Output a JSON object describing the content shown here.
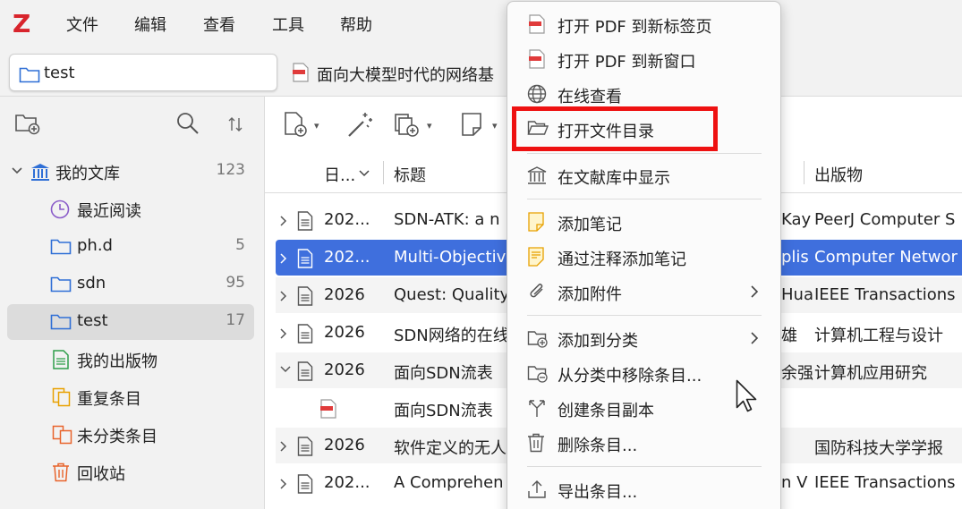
{
  "app": {
    "logo_letter": "Z"
  },
  "menubar": [
    "文件",
    "编辑",
    "查看",
    "工具",
    "帮助"
  ],
  "tabs": [
    {
      "label": "test",
      "active": true
    },
    {
      "label": "面向大模型时代的网络基",
      "active": false
    }
  ],
  "sidebar": {
    "tree": [
      {
        "label": "我的文库",
        "count": "123",
        "icon": "library-icon"
      },
      {
        "label": "最近阅读",
        "count": "",
        "icon": "clock-icon"
      },
      {
        "label": "ph.d",
        "count": "5",
        "icon": "folder-icon"
      },
      {
        "label": "sdn",
        "count": "95",
        "icon": "folder-icon"
      },
      {
        "label": "test",
        "count": "17",
        "icon": "folder-icon",
        "selected": true
      },
      {
        "label": "我的出版物",
        "count": "",
        "icon": "publications-icon"
      },
      {
        "label": "重复条目",
        "count": "",
        "icon": "duplicates-icon"
      },
      {
        "label": "未分类条目",
        "count": "",
        "icon": "unfiled-icon"
      },
      {
        "label": "回收站",
        "count": "",
        "icon": "trash-icon"
      }
    ]
  },
  "columns": {
    "date": "日...",
    "title": "标题",
    "publication": "出版物"
  },
  "rows": [
    {
      "date": "202...",
      "title": "SDN-ATK: a n",
      "creator": "Kay",
      "publication": "PeerJ Computer S"
    },
    {
      "date": "202...",
      "title": "Multi-Objectiv",
      "creator": "plis",
      "publication": "Computer Networ",
      "selected": true
    },
    {
      "date": "2026",
      "title": "Quest: Quality",
      "creator": "Hua",
      "publication": "IEEE Transactions"
    },
    {
      "date": "2026",
      "title": "SDN网络的在线",
      "creator": "雄",
      "publication": "计算机工程与设计"
    },
    {
      "date": "2026",
      "title": "面向SDN流表",
      "creator": "余强",
      "publication": "计算机应用研究",
      "expanded": true
    },
    {
      "date": "",
      "title": "面向SDN流表",
      "creator": "",
      "publication": "",
      "attachment": true
    },
    {
      "date": "2026",
      "title": "软件定义的无人",
      "creator": "",
      "publication": "国防科技大学学报"
    },
    {
      "date": "202...",
      "title": "A Comprehen",
      "creator": "n V",
      "publication": "IEEE Transactions"
    }
  ],
  "context_menu": {
    "items": [
      {
        "label": "打开 PDF 到新标签页",
        "icon": "pdf-tab-icon"
      },
      {
        "label": "打开 PDF 到新窗口",
        "icon": "pdf-window-icon"
      },
      {
        "label": "在线查看",
        "icon": "globe-icon"
      },
      {
        "label": "打开文件目录",
        "icon": "folder-open-icon",
        "highlighted": true
      },
      {
        "label": "在文献库中显示",
        "icon": "library-icon"
      },
      {
        "label": "添加笔记",
        "icon": "note-icon"
      },
      {
        "label": "通过注释添加笔记",
        "icon": "annotation-note-icon"
      },
      {
        "label": "添加附件",
        "icon": "paperclip-icon",
        "submenu": true
      },
      {
        "label": "添加到分类",
        "icon": "folder-add-icon",
        "submenu": true
      },
      {
        "label": "从分类中移除条目...",
        "icon": "folder-remove-icon"
      },
      {
        "label": "创建条目副本",
        "icon": "duplicate-icon"
      },
      {
        "label": "删除条目...",
        "icon": "trash-icon"
      },
      {
        "label": "导出条目...",
        "icon": "export-icon"
      }
    ]
  },
  "colors": {
    "accent": "#3f6fdd",
    "highlight_box": "#ee1111",
    "logo": "#d8242c",
    "folder": "#2f6fd6"
  }
}
